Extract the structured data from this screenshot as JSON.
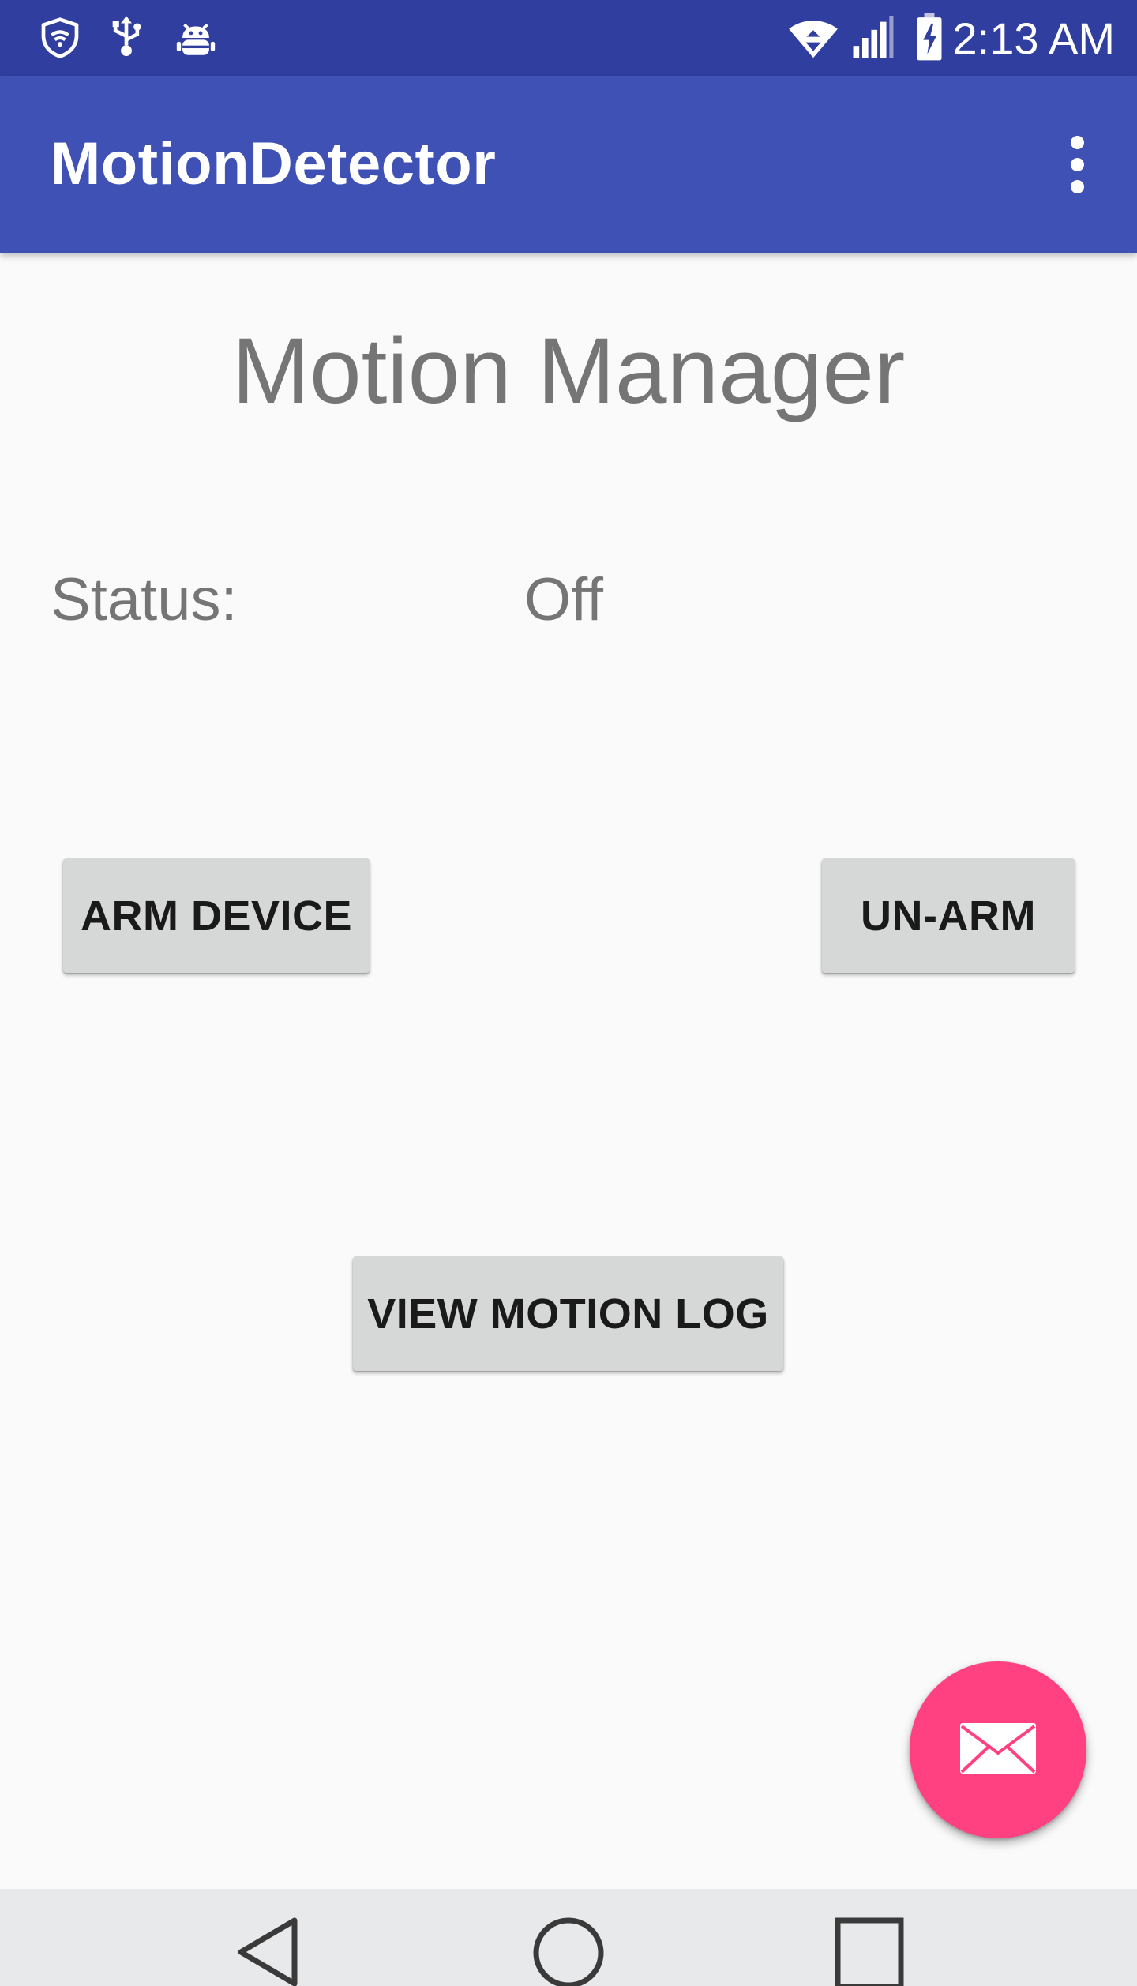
{
  "status_bar": {
    "time": "2:13 AM",
    "left_icons": [
      "shield-wifi-icon",
      "usb-icon",
      "android-debug-icon"
    ],
    "right_icons": [
      "wifi-icon",
      "signal-icon",
      "battery-charging-icon"
    ]
  },
  "app_bar": {
    "title": "MotionDetector",
    "overflow_icon": "more-vert-icon"
  },
  "main": {
    "heading": "Motion Manager",
    "status_label": "Status:",
    "status_value": "Off",
    "arm_button": "ARM DEVICE",
    "unarm_button": "UN-ARM",
    "log_button": "VIEW MOTION LOG"
  },
  "fab": {
    "icon": "email-icon"
  },
  "nav_bar": {
    "icons": [
      "back-icon",
      "home-icon",
      "recents-icon"
    ]
  },
  "colors": {
    "status_bar": "#303F9F",
    "app_bar": "#3F51B5",
    "fab": "#FF4081",
    "background": "#FAFAFA",
    "button": "#D6D7D7",
    "nav_bar": "#E8E9EB"
  }
}
